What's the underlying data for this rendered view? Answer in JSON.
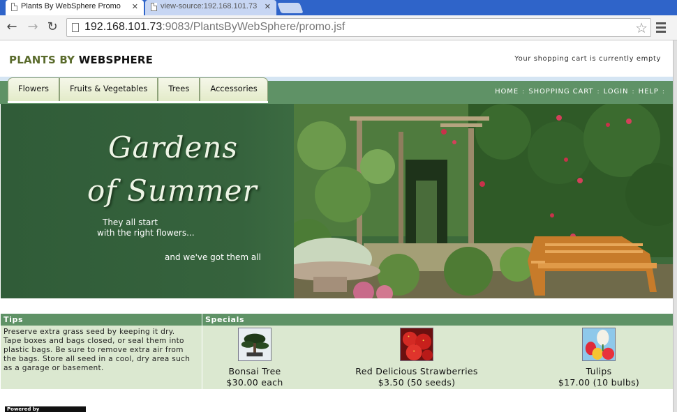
{
  "browser": {
    "tabs": [
      {
        "title": "Plants By WebSphere Promo",
        "active": true
      },
      {
        "title": "view-source:192.168.101.73",
        "active": false
      }
    ],
    "url_host": "192.168.101.73",
    "url_rest": ":9083/PlantsByWebSphere/promo.jsf",
    "icons": {
      "back": "back-arrow-icon",
      "forward": "forward-arrow-icon",
      "reload": "reload-icon",
      "bookmark": "star-icon",
      "menu": "hamburger-menu-icon",
      "close": "close-icon"
    }
  },
  "header": {
    "logo_part1": "PLANTS BY",
    "logo_part2": "WEBSPHERE",
    "cart_message": "Your shopping cart is currently empty"
  },
  "nav": {
    "tabs": [
      {
        "label": "Flowers"
      },
      {
        "label": "Fruits & Vegetables"
      },
      {
        "label": "Trees"
      },
      {
        "label": "Accessories"
      }
    ],
    "links": [
      {
        "label": "HOME"
      },
      {
        "label": "SHOPPING CART"
      },
      {
        "label": "LOGIN"
      },
      {
        "label": "HELP"
      }
    ],
    "separator": ":"
  },
  "banner": {
    "headline_line1": "Gardens",
    "headline_line2": "of Summer",
    "tagline_line1": "They all start",
    "tagline_line2": "with the right flowers...",
    "tagline_line3": "and we've got them all"
  },
  "tips": {
    "heading": "Tips",
    "lines": [
      "Preserve extra grass seed by keeping it dry.",
      "Tape boxes and bags closed, or seal them into",
      "plastic bags. Be sure to remove extra air from",
      "the bags. Store all seed in a cool, dry area such",
      "as a garage or basement."
    ]
  },
  "specials": {
    "heading": "Specials",
    "items": [
      {
        "name": "Bonsai Tree",
        "price": "$30.00 each",
        "icon": "bonsai-tree-thumbnail"
      },
      {
        "name": "Red Delicious Strawberries",
        "price": "$3.50 (50 seeds)",
        "icon": "strawberries-thumbnail"
      },
      {
        "name": "Tulips",
        "price": "$17.00 (10 bulbs)",
        "icon": "tulips-thumbnail"
      }
    ]
  },
  "footer": {
    "powered_by": "Powered by"
  },
  "colors": {
    "nav_green": "#5f9266",
    "panel_green": "#dbe8d0",
    "banner_green": "#305c38",
    "logo_olive": "#5a6b2c"
  }
}
